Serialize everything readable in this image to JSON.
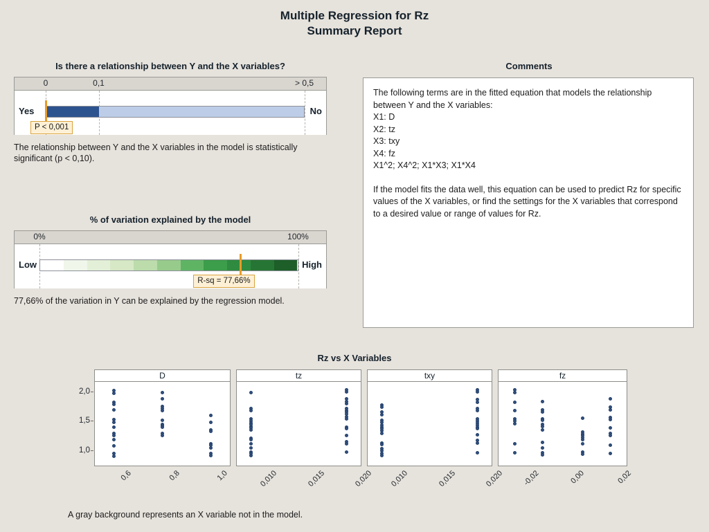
{
  "report": {
    "title_line1": "Multiple Regression for Rz",
    "title_line2": "Summary Report"
  },
  "relationship_panel": {
    "heading": "Is there a relationship between Y and the X variables?",
    "scale_labels": [
      "0",
      "0,1",
      "> 0,5"
    ],
    "left_cap": "Yes",
    "right_cap": "No",
    "callout": "P < 0,001",
    "note": "The relationship between Y and the X variables in the model is statistically significant (p < 0,10)."
  },
  "variation_panel": {
    "heading": "% of variation explained by the model",
    "scale_labels": [
      "0%",
      "100%"
    ],
    "left_cap": "Low",
    "right_cap": "High",
    "callout": "R-sq = 77,66%",
    "note": "77,66% of the variation in Y can be explained by the regression model."
  },
  "comments_panel": {
    "heading": "Comments",
    "paragraph1": "The following terms are in the fitted equation that models the relationship between Y and the X variables:\nX1: D\nX2: tz\nX3: txy\nX4: fz\nX1^2; X4^2; X1*X3; X1*X4",
    "paragraph2": "If the model fits the data well, this equation can be used to predict Rz for specific values of the X variables, or find the settings for the X variables that correspond to a desired value or range of values for Rz."
  },
  "scatter_section": {
    "title": "Rz vs X Variables",
    "footer_note": "A gray background represents an X variable not in the model.",
    "y_ticks": [
      "1,0",
      "1,5",
      "2,0"
    ]
  },
  "colors": {
    "page_background": "#e6e2dc",
    "panel_background": "#ffffff",
    "scale_strip": "#d9d5cf",
    "bar_dark_blue": "#2d538f",
    "bar_light_blue": "#bdcde8",
    "marker_orange": "#e89b2a",
    "callout_fill": "#fdf0d5",
    "dot_blue": "#31507e",
    "border_gray": "#9a9a96"
  },
  "chart_data": [
    {
      "type": "bar",
      "title": "Is there a relationship between Y and the X variables?",
      "orientation": "horizontal-gauge",
      "xlabel": "p-value",
      "ylabel": "",
      "xlim": [
        0,
        0.5
      ],
      "ticks": [
        {
          "label": "0",
          "pos_pct": 10
        },
        {
          "label": "0,1",
          "pos_pct": 27
        },
        {
          "label": "> 0,5",
          "pos_pct": 93
        }
      ],
      "value": 0.001,
      "value_label": "P < 0,001",
      "marker_pos_pct": 10,
      "segments": [
        {
          "name": "significant",
          "from_pct": 10,
          "to_pct": 27,
          "color": "#2d538f"
        },
        {
          "name": "not-significant",
          "from_pct": 27,
          "to_pct": 93,
          "color": "#bdcde8"
        }
      ]
    },
    {
      "type": "bar",
      "title": "% of variation explained by the model",
      "orientation": "horizontal-gauge",
      "xlabel": "R-squared",
      "ylabel": "",
      "xlim": [
        0,
        100
      ],
      "ticks": [
        {
          "label": "0%",
          "pos_pct": 8
        },
        {
          "label": "100%",
          "pos_pct": 91
        }
      ],
      "value": 77.66,
      "value_label": "R-sq = 77,66%",
      "marker_pos_pct": 72.5,
      "gradient_colors": [
        "#ffffff",
        "#f0f6ea",
        "#e4efd8",
        "#d6e8c5",
        "#bcdcac",
        "#97cb8c",
        "#5fb464",
        "#3c9d4a",
        "#2f8b3f",
        "#277534",
        "#1d5e29"
      ]
    },
    {
      "type": "scatter",
      "title": "Rz vs X Variables",
      "ylabel": "Rz",
      "ylim": [
        0.85,
        2.1
      ],
      "ytick_values": [
        1.0,
        1.5,
        2.0
      ],
      "ytick_labels": [
        "1,0",
        "1,5",
        "2,0"
      ],
      "grid": false,
      "legend": "none",
      "panels": [
        {
          "name": "D",
          "in_model": true,
          "xlim": [
            0.52,
            1.08
          ],
          "xtick_values": [
            0.6,
            0.8,
            1.0
          ],
          "xtick_labels": [
            "0,6",
            "0,8",
            "1,0"
          ],
          "points": [
            {
              "x": 0.6,
              "y": 2.02
            },
            {
              "x": 0.6,
              "y": 1.98
            },
            {
              "x": 0.6,
              "y": 1.83
            },
            {
              "x": 0.6,
              "y": 1.79
            },
            {
              "x": 0.6,
              "y": 1.7
            },
            {
              "x": 0.6,
              "y": 1.53
            },
            {
              "x": 0.6,
              "y": 1.49
            },
            {
              "x": 0.6,
              "y": 1.4
            },
            {
              "x": 0.6,
              "y": 1.3
            },
            {
              "x": 0.6,
              "y": 1.27
            },
            {
              "x": 0.6,
              "y": 1.2
            },
            {
              "x": 0.6,
              "y": 1.09
            },
            {
              "x": 0.6,
              "y": 0.96
            },
            {
              "x": 0.6,
              "y": 0.92
            },
            {
              "x": 0.8,
              "y": 1.99
            },
            {
              "x": 0.8,
              "y": 1.88
            },
            {
              "x": 0.8,
              "y": 1.76
            },
            {
              "x": 0.8,
              "y": 1.72
            },
            {
              "x": 0.8,
              "y": 1.68
            },
            {
              "x": 0.8,
              "y": 1.52
            },
            {
              "x": 0.8,
              "y": 1.45
            },
            {
              "x": 0.8,
              "y": 1.43
            },
            {
              "x": 0.8,
              "y": 1.4
            },
            {
              "x": 0.8,
              "y": 1.3
            },
            {
              "x": 0.8,
              "y": 1.27
            },
            {
              "x": 1.0,
              "y": 1.6
            },
            {
              "x": 1.0,
              "y": 1.49
            },
            {
              "x": 1.0,
              "y": 1.36
            },
            {
              "x": 1.0,
              "y": 1.33
            },
            {
              "x": 1.0,
              "y": 1.13
            },
            {
              "x": 1.0,
              "y": 1.1
            },
            {
              "x": 1.0,
              "y": 1.05
            },
            {
              "x": 1.0,
              "y": 0.96
            },
            {
              "x": 1.0,
              "y": 0.93
            }
          ]
        },
        {
          "name": "tz",
          "in_model": true,
          "xlim": [
            0.0085,
            0.0215
          ],
          "xtick_values": [
            0.01,
            0.015,
            0.02
          ],
          "xtick_labels": [
            "0,010",
            "0,015",
            "0,020"
          ],
          "points": [
            {
              "x": 0.01,
              "y": 1.99
            },
            {
              "x": 0.01,
              "y": 1.72
            },
            {
              "x": 0.01,
              "y": 1.68
            },
            {
              "x": 0.01,
              "y": 1.54
            },
            {
              "x": 0.01,
              "y": 1.51
            },
            {
              "x": 0.01,
              "y": 1.48
            },
            {
              "x": 0.01,
              "y": 1.45
            },
            {
              "x": 0.01,
              "y": 1.42
            },
            {
              "x": 0.01,
              "y": 1.39
            },
            {
              "x": 0.01,
              "y": 1.36
            },
            {
              "x": 0.01,
              "y": 1.22
            },
            {
              "x": 0.01,
              "y": 1.19
            },
            {
              "x": 0.01,
              "y": 1.12
            },
            {
              "x": 0.01,
              "y": 1.06
            },
            {
              "x": 0.01,
              "y": 0.99
            },
            {
              "x": 0.01,
              "y": 0.96
            },
            {
              "x": 0.01,
              "y": 0.93
            },
            {
              "x": 0.02,
              "y": 2.04
            },
            {
              "x": 0.02,
              "y": 2.0
            },
            {
              "x": 0.02,
              "y": 1.88
            },
            {
              "x": 0.02,
              "y": 1.84
            },
            {
              "x": 0.02,
              "y": 1.8
            },
            {
              "x": 0.02,
              "y": 1.72
            },
            {
              "x": 0.02,
              "y": 1.69
            },
            {
              "x": 0.02,
              "y": 1.66
            },
            {
              "x": 0.02,
              "y": 1.63
            },
            {
              "x": 0.02,
              "y": 1.58
            },
            {
              "x": 0.02,
              "y": 1.55
            },
            {
              "x": 0.02,
              "y": 1.41
            },
            {
              "x": 0.02,
              "y": 1.38
            },
            {
              "x": 0.02,
              "y": 1.26
            },
            {
              "x": 0.02,
              "y": 1.16
            },
            {
              "x": 0.02,
              "y": 1.13
            },
            {
              "x": 0.02,
              "y": 0.98
            }
          ]
        },
        {
          "name": "txy",
          "in_model": true,
          "xlim": [
            0.0085,
            0.0215
          ],
          "xtick_values": [
            0.01,
            0.015,
            0.02
          ],
          "xtick_labels": [
            "0,010",
            "0,015",
            "0,020"
          ],
          "points": [
            {
              "x": 0.01,
              "y": 1.78
            },
            {
              "x": 0.01,
              "y": 1.74
            },
            {
              "x": 0.01,
              "y": 1.66
            },
            {
              "x": 0.01,
              "y": 1.62
            },
            {
              "x": 0.01,
              "y": 1.52
            },
            {
              "x": 0.01,
              "y": 1.49
            },
            {
              "x": 0.01,
              "y": 1.44
            },
            {
              "x": 0.01,
              "y": 1.41
            },
            {
              "x": 0.01,
              "y": 1.38
            },
            {
              "x": 0.01,
              "y": 1.35
            },
            {
              "x": 0.01,
              "y": 1.3
            },
            {
              "x": 0.01,
              "y": 1.14
            },
            {
              "x": 0.01,
              "y": 1.11
            },
            {
              "x": 0.01,
              "y": 1.04
            },
            {
              "x": 0.01,
              "y": 1.01
            },
            {
              "x": 0.01,
              "y": 0.96
            },
            {
              "x": 0.01,
              "y": 0.93
            },
            {
              "x": 0.02,
              "y": 2.04
            },
            {
              "x": 0.02,
              "y": 2.0
            },
            {
              "x": 0.02,
              "y": 1.87
            },
            {
              "x": 0.02,
              "y": 1.83
            },
            {
              "x": 0.02,
              "y": 1.72
            },
            {
              "x": 0.02,
              "y": 1.68
            },
            {
              "x": 0.02,
              "y": 1.54
            },
            {
              "x": 0.02,
              "y": 1.51
            },
            {
              "x": 0.02,
              "y": 1.47
            },
            {
              "x": 0.02,
              "y": 1.44
            },
            {
              "x": 0.02,
              "y": 1.41
            },
            {
              "x": 0.02,
              "y": 1.38
            },
            {
              "x": 0.02,
              "y": 1.28
            },
            {
              "x": 0.02,
              "y": 1.18
            },
            {
              "x": 0.02,
              "y": 1.14
            },
            {
              "x": 0.02,
              "y": 0.97
            }
          ]
        },
        {
          "name": "fz",
          "in_model": true,
          "xlim": [
            -0.027,
            0.027
          ],
          "xtick_values": [
            -0.02,
            0.0,
            0.02
          ],
          "xtick_labels": [
            "-0,02",
            "0,00",
            "0,02"
          ],
          "points": [
            {
              "x": -0.02,
              "y": 2.03
            },
            {
              "x": -0.02,
              "y": 1.99
            },
            {
              "x": -0.02,
              "y": 1.82
            },
            {
              "x": -0.02,
              "y": 1.69
            },
            {
              "x": -0.02,
              "y": 1.54
            },
            {
              "x": -0.02,
              "y": 1.51
            },
            {
              "x": -0.02,
              "y": 1.46
            },
            {
              "x": -0.02,
              "y": 1.13
            },
            {
              "x": -0.02,
              "y": 0.97
            },
            {
              "x": -0.0085,
              "y": 1.84
            },
            {
              "x": -0.0085,
              "y": 1.7
            },
            {
              "x": -0.0085,
              "y": 1.66
            },
            {
              "x": -0.0085,
              "y": 1.55
            },
            {
              "x": -0.0085,
              "y": 1.52
            },
            {
              "x": -0.0085,
              "y": 1.45
            },
            {
              "x": -0.0085,
              "y": 1.42
            },
            {
              "x": -0.0085,
              "y": 1.36
            },
            {
              "x": -0.0085,
              "y": 1.15
            },
            {
              "x": -0.0085,
              "y": 1.05
            },
            {
              "x": -0.0085,
              "y": 0.97
            },
            {
              "x": -0.0085,
              "y": 0.94
            },
            {
              "x": 0.0085,
              "y": 1.56
            },
            {
              "x": 0.0085,
              "y": 1.32
            },
            {
              "x": 0.0085,
              "y": 1.29
            },
            {
              "x": 0.0085,
              "y": 1.26
            },
            {
              "x": 0.0085,
              "y": 1.23
            },
            {
              "x": 0.0085,
              "y": 1.2
            },
            {
              "x": 0.0085,
              "y": 1.13
            },
            {
              "x": 0.0085,
              "y": 0.99
            },
            {
              "x": 0.0085,
              "y": 0.95
            },
            {
              "x": 0.02,
              "y": 1.88
            },
            {
              "x": 0.02,
              "y": 1.74
            },
            {
              "x": 0.02,
              "y": 1.7
            },
            {
              "x": 0.02,
              "y": 1.57
            },
            {
              "x": 0.02,
              "y": 1.53
            },
            {
              "x": 0.02,
              "y": 1.39
            },
            {
              "x": 0.02,
              "y": 1.3
            },
            {
              "x": 0.02,
              "y": 1.27
            },
            {
              "x": 0.02,
              "y": 1.1
            },
            {
              "x": 0.02,
              "y": 0.96
            }
          ]
        }
      ]
    }
  ]
}
